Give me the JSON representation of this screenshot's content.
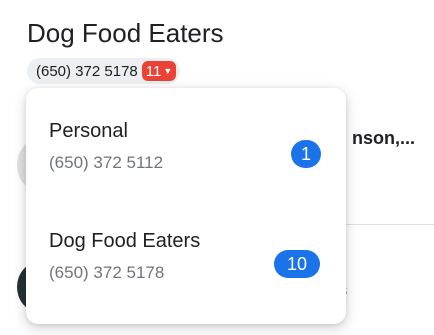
{
  "header": {
    "title": "Dog Food Eaters"
  },
  "account_chip": {
    "number": "(650) 372 5178",
    "unread_count": "11",
    "caret_icon": "caret-down-icon"
  },
  "background": {
    "conversation_title": "nson,...",
    "snippet": "s"
  },
  "popup": {
    "items": [
      {
        "name": "Personal",
        "number": "(650) 372 5112",
        "count": "1"
      },
      {
        "name": "Dog Food Eaters",
        "number": "(650) 372 5178",
        "count": "10"
      }
    ]
  },
  "colors": {
    "badge_red": "#ea4335",
    "badge_blue": "#1a73e8",
    "chip_bg": "#eceff1"
  }
}
